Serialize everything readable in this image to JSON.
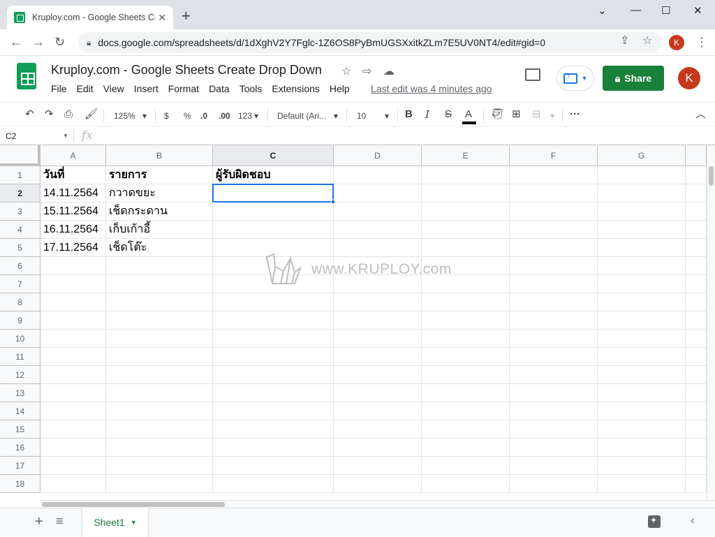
{
  "browser": {
    "tab_title": "Kruploy.com - Google Sheets Cre",
    "new_tab": "+",
    "url": "docs.google.com/spreadsheets/d/1dXghV2Y7Fglc-1Z6OS8PyBmUGSXxitkZLm7E5UV0NT4/edit#gid=0",
    "profile_initial": "K"
  },
  "doc": {
    "title": "Kruploy.com - Google Sheets Create Drop Down",
    "menu": [
      "File",
      "Edit",
      "View",
      "Insert",
      "Format",
      "Data",
      "Tools",
      "Extensions",
      "Help"
    ],
    "last_edit": "Last edit was 4 minutes ago",
    "share_label": "Share",
    "avatar_initial": "K"
  },
  "toolbar": {
    "zoom": "125%",
    "currency": "$",
    "percent": "%",
    "decimal_decrease": ".0",
    "decimal_increase": ".00",
    "number_format": "123",
    "font": "Default (Ari...",
    "font_size": "10",
    "bold": "B",
    "italic": "I",
    "strike": "S",
    "text_color": "A",
    "more": "···"
  },
  "formula_bar": {
    "name_box": "C2",
    "fx": "fx",
    "value": ""
  },
  "grid": {
    "columns": [
      "A",
      "B",
      "C",
      "D",
      "E",
      "F",
      "G"
    ],
    "active_column": "C",
    "rows": [
      "1",
      "2",
      "3",
      "4",
      "5",
      "6",
      "7",
      "8",
      "9",
      "10",
      "11",
      "12",
      "13",
      "14",
      "15",
      "16",
      "17",
      "18"
    ],
    "active_row": "2",
    "cells": {
      "A1": "วันที่",
      "B1": "รายการ",
      "C1": "ผู้รับผิดชอบ",
      "A2": "14.11.2564",
      "B2": "กวาดขยะ",
      "A3": "15.11.2564",
      "B3": "เช็ดกระดาน",
      "A4": "16.11.2564",
      "B4": "เก็บเก้าอี้",
      "A5": "17.11.2564",
      "B5": "เช็ดโต๊ะ"
    },
    "selected_cell": "C2",
    "watermark": "www.KRUPLOY.com"
  },
  "sheets": {
    "tabs": [
      "Sheet1"
    ],
    "active": "Sheet1"
  },
  "colors": {
    "sheets_green": "#0f9d58",
    "share_green": "#188038",
    "selection_blue": "#1a73e8",
    "avatar_red": "#c5391c"
  }
}
